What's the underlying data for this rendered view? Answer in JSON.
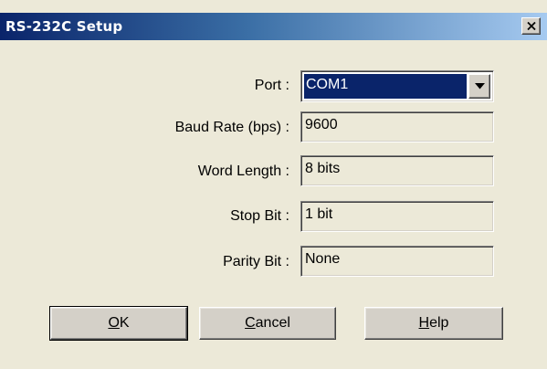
{
  "window": {
    "title": "RS-232C Setup",
    "close_icon": "close-icon",
    "close_glyph": "×"
  },
  "fields": {
    "port": {
      "label": "Port :",
      "value": "COM1",
      "options": [
        "COM1"
      ]
    },
    "baud_rate": {
      "label": "Baud Rate (bps) :",
      "value": "9600"
    },
    "word_length": {
      "label": "Word Length :",
      "value": "8 bits"
    },
    "stop_bit": {
      "label": "Stop Bit :",
      "value": "1 bit"
    },
    "parity_bit": {
      "label": "Parity Bit :",
      "value": "None"
    }
  },
  "buttons": {
    "ok": {
      "mnemonic": "O",
      "rest": "K"
    },
    "cancel": {
      "mnemonic": "C",
      "rest": "ancel"
    },
    "help": {
      "mnemonic": "H",
      "rest": "elp"
    }
  },
  "colors": {
    "title_bar_start": "#0a246a",
    "title_bar_end": "#a6caf0",
    "dialog_bg": "#ece9d8",
    "selection": "#0a246a"
  }
}
